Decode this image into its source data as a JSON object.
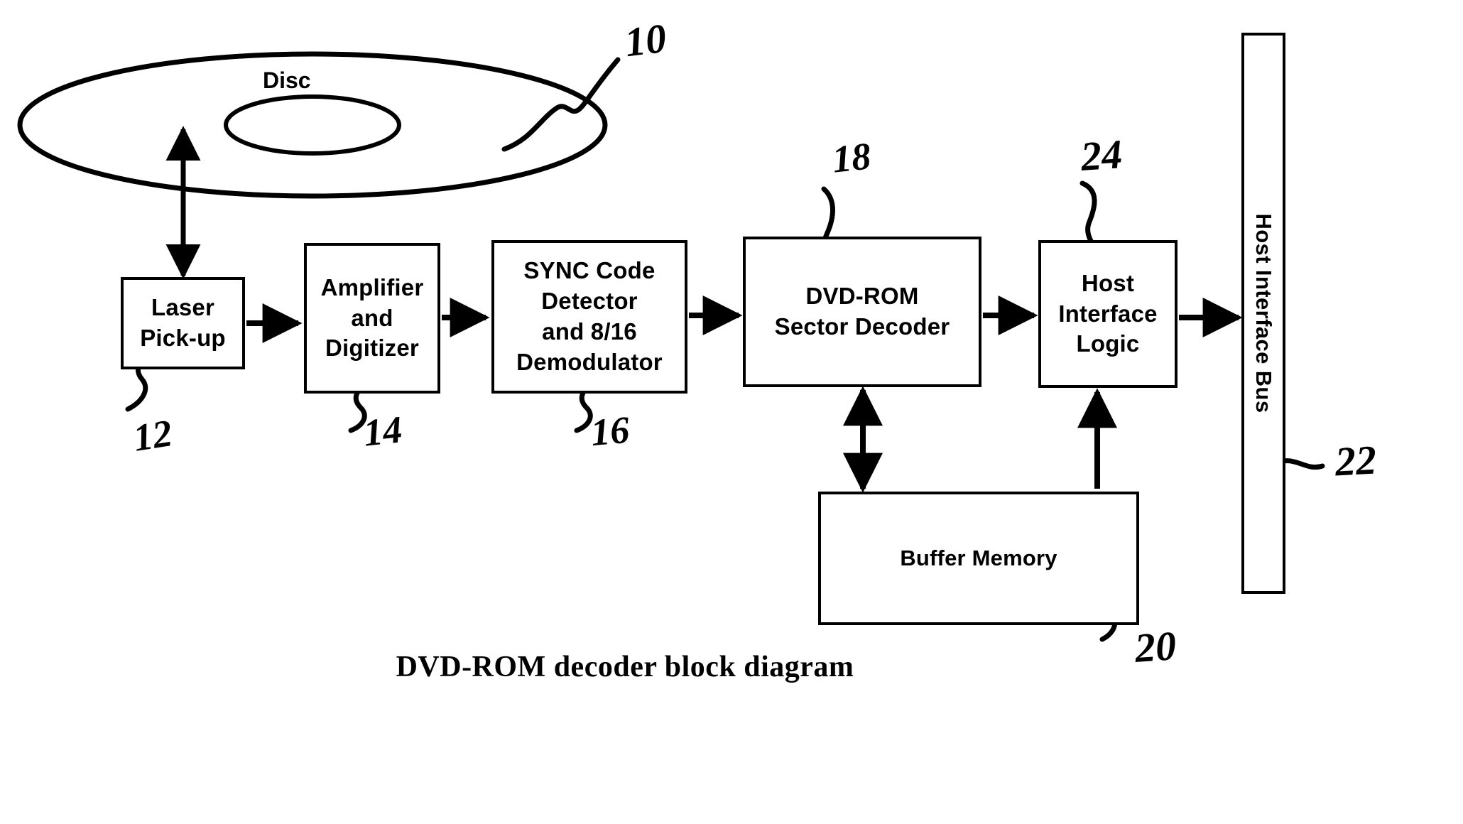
{
  "figure": {
    "caption": "DVD-ROM decoder block diagram",
    "disc_label": "Disc",
    "bus_label": "Host Interface Bus"
  },
  "blocks": [
    {
      "id": "laser",
      "label": "Laser\nPick-up",
      "ref": "12"
    },
    {
      "id": "amplifier",
      "label": "Amplifier\nand\nDigitizer",
      "ref": "14"
    },
    {
      "id": "sync",
      "label": "SYNC Code\nDetector\nand 8/16\nDemodulator",
      "ref": "16"
    },
    {
      "id": "decoder",
      "label": "DVD-ROM\nSector Decoder",
      "ref": "18"
    },
    {
      "id": "host",
      "label": "Host\nInterface\nLogic",
      "ref": "24"
    },
    {
      "id": "buffer",
      "label": "Buffer Memory",
      "ref": "20"
    }
  ],
  "reference_numerals": {
    "disc": "10",
    "laser": "12",
    "amplifier": "14",
    "sync": "16",
    "decoder": "18",
    "buffer": "20",
    "bus": "22",
    "host": "24"
  },
  "colors": {
    "ink": "#000000",
    "background": "#ffffff"
  }
}
